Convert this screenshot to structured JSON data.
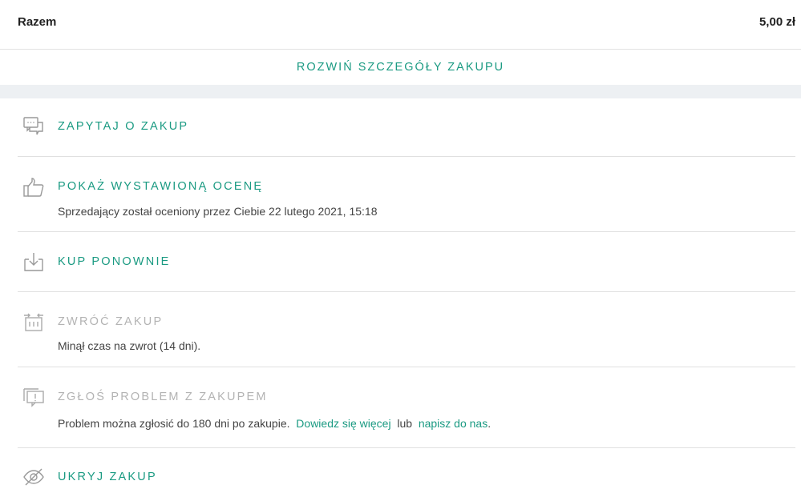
{
  "summary": {
    "total_label": "Razem",
    "total_value": "5,00 zł"
  },
  "expand_label": "ROZWIŃ SZCZEGÓŁY ZAKUPU",
  "actions": [
    {
      "title": "ZAPYTAJ O ZAKUP",
      "icon": "chat-bubbles-icon"
    },
    {
      "title": "POKAŻ WYSTAWIONĄ OCENĘ",
      "icon": "thumbs-up-icon",
      "desc": "Sprzedający został oceniony przez Ciebie 22 lutego 2021, 15:18"
    },
    {
      "title": "KUP PONOWNIE",
      "icon": "download-box-icon"
    },
    {
      "title": "ZWRÓĆ ZAKUP",
      "icon": "return-box-icon",
      "disabled": true,
      "desc": "Minął czas na zwrot (14 dni)."
    },
    {
      "title": "ZGŁOŚ PROBLEM Z ZAKUPEM",
      "icon": "report-problem-icon",
      "disabled": true,
      "desc_text": "Problem można zgłosić do 180 dni po zakupie.",
      "learn_more": "Dowiedz się więcej",
      "or": "lub",
      "contact": "napisz do nas",
      "end": "."
    },
    {
      "title": "UKRYJ ZAKUP",
      "icon": "eye-slash-icon"
    }
  ],
  "colors": {
    "accent": "#1a9a82",
    "disabled": "#b3b3b3",
    "separator": "#e0e0e0",
    "band": "#edf0f3"
  }
}
